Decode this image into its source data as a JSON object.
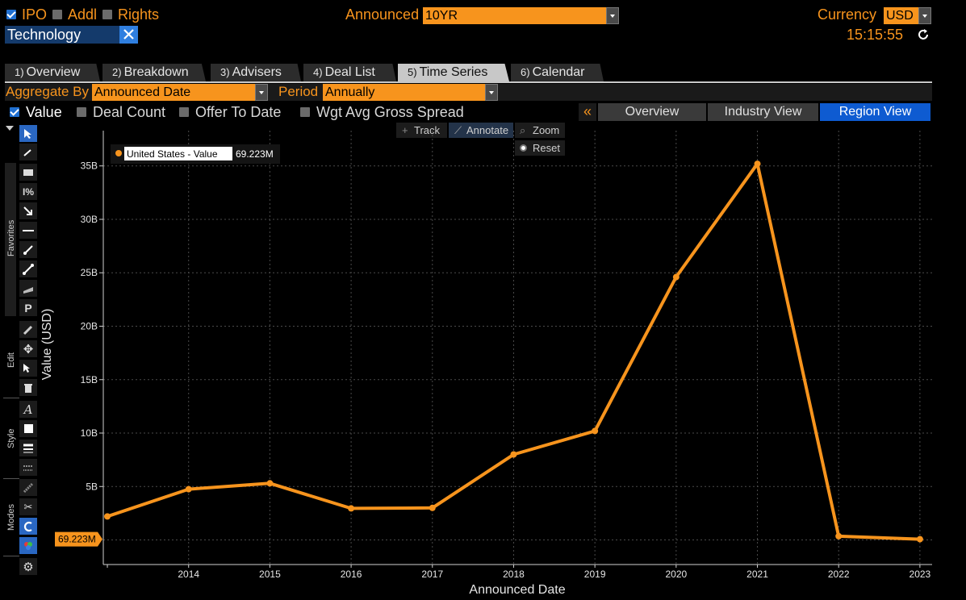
{
  "header": {
    "ipo_label": "IPO",
    "addl_label": "Addl",
    "rights_label": "Rights",
    "announced_label": "Announced",
    "announced_value": "10YR",
    "currency_label": "Currency",
    "currency_value": "USD",
    "filter_tag": "Technology",
    "time": "15:15:55"
  },
  "tabs": [
    {
      "num": "1)",
      "label": "Overview"
    },
    {
      "num": "2)",
      "label": "Breakdown"
    },
    {
      "num": "3)",
      "label": "Advisers"
    },
    {
      "num": "4)",
      "label": "Deal List"
    },
    {
      "num": "5)",
      "label": "Time Series"
    },
    {
      "num": "6)",
      "label": "Calendar"
    }
  ],
  "controls": {
    "aggregate_label": "Aggregate By",
    "aggregate_value": "Announced Date",
    "period_label": "Period",
    "period_value": "Annually",
    "value_label": "Value",
    "deal_count_label": "Deal Count",
    "offer_to_date_label": "Offer To Date",
    "wgt_avg_label": "Wgt Avg Gross Spread",
    "collapse_glyph": "«",
    "views": [
      "Overview",
      "Industry View",
      "Region View"
    ]
  },
  "chart_modes": {
    "track": "Track",
    "annotate": "Annotate",
    "zoom": "Zoom",
    "reset": "Reset"
  },
  "toolbar_groups": {
    "favorites": "Favorites",
    "edit": "Edit",
    "style": "Style",
    "modes": "Modes"
  },
  "colors": {
    "accent": "#f7941d",
    "selected_blue": "#0e5bd1",
    "line": "#f7941d"
  },
  "chart_data": {
    "type": "line",
    "title": "",
    "xlabel": "Announced Date",
    "ylabel": "Value (USD)",
    "x": [
      2013,
      2014,
      2015,
      2016,
      2017,
      2018,
      2019,
      2020,
      2021,
      2022,
      2023
    ],
    "x_tick_labels": [
      "2014",
      "2015",
      "2016",
      "2017",
      "2018",
      "2019",
      "2020",
      "2021",
      "2022",
      "2023"
    ],
    "y_tick_values": [
      5,
      10,
      15,
      20,
      25,
      30,
      35
    ],
    "y_tick_labels": [
      "5B",
      "10B",
      "15B",
      "20B",
      "25B",
      "30B",
      "35B"
    ],
    "ylim": [
      -2.3,
      38.3
    ],
    "y_unit": "B",
    "series": [
      {
        "name": "United States - Value",
        "values": [
          2.2,
          4.75,
          5.3,
          2.95,
          3.0,
          8.0,
          10.2,
          24.6,
          35.2,
          0.35,
          0.069223
        ]
      }
    ],
    "legend": {
      "label": "United States - Value",
      "value": "69.223M",
      "position": "top-left"
    },
    "last_value_label": "69.223M",
    "grid": true
  }
}
